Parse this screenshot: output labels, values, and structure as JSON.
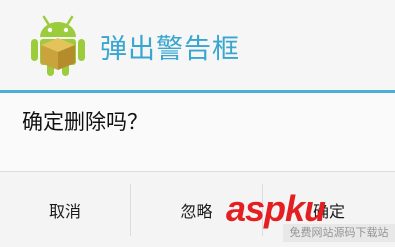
{
  "dialog": {
    "title": "弹出警告框",
    "icon": "android-robot-icon",
    "message": "确定删除吗？",
    "buttons": {
      "cancel": "取消",
      "ignore": "忽略",
      "ok": "确定"
    }
  },
  "watermark": {
    "logo": "aspku",
    "tagline": "免费网站源码下载站"
  },
  "colors": {
    "accent": "#38a6d0",
    "divider": "#4aaed6",
    "android_green": "#9ccc3c",
    "watermark_red": "#e41f21"
  }
}
